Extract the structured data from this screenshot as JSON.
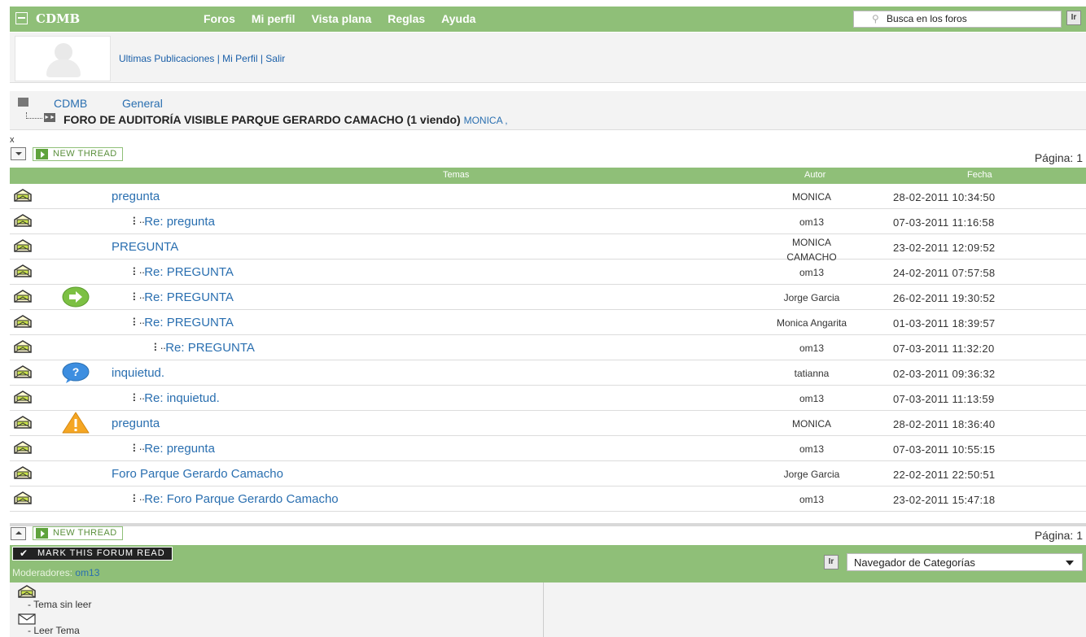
{
  "topbar": {
    "brand": "CDMB",
    "nav": [
      "Foros",
      "Mi perfil",
      "Vista plana",
      "Reglas",
      "Ayuda"
    ],
    "search_placeholder": "Busca en los foros",
    "go_label": "Ir"
  },
  "userpanel": {
    "links": "Ultimas Publicaciones | Mi Perfil | Salir"
  },
  "breadcrumb": {
    "root": "CDMB",
    "category": "General",
    "forum": "FORO DE AUDITORÍA VISIBLE PARQUE GERARDO CAMACHO (1 viendo)",
    "viewers": "MONICA ,"
  },
  "controls": {
    "close": "x",
    "new_thread": "NEW THREAD",
    "page": "Página: 1"
  },
  "table": {
    "headers": {
      "topics": "Temas",
      "author": "Autor",
      "date": "Fecha"
    },
    "rows": [
      {
        "subject": "pregunta",
        "level": 0,
        "author": "MONICA",
        "date": "28-02-2011 10:34:50",
        "icon": ""
      },
      {
        "subject": "Re: pregunta",
        "level": 1,
        "author": "om13",
        "date": "07-03-2011 11:16:58",
        "icon": ""
      },
      {
        "subject": "PREGUNTA",
        "level": 0,
        "author": "MONICA CAMACHO",
        "date": "23-02-2011 12:09:52",
        "icon": ""
      },
      {
        "subject": "Re: PREGUNTA",
        "level": 1,
        "author": "om13",
        "date": "24-02-2011 07:57:58",
        "icon": ""
      },
      {
        "subject": "Re: PREGUNTA",
        "level": 1,
        "author": "Jorge Garcia",
        "date": "26-02-2011 19:30:52",
        "icon": "arrow-icon"
      },
      {
        "subject": "Re: PREGUNTA",
        "level": 1,
        "author": "Monica Angarita",
        "date": "01-03-2011 18:39:57",
        "icon": ""
      },
      {
        "subject": "Re: PREGUNTA",
        "level": 2,
        "author": "om13",
        "date": "07-03-2011 11:32:20",
        "icon": ""
      },
      {
        "subject": "inquietud.",
        "level": 0,
        "author": "tatianna",
        "date": "02-03-2011 09:36:32",
        "icon": "question-icon"
      },
      {
        "subject": "Re: inquietud.",
        "level": 1,
        "author": "om13",
        "date": "07-03-2011 11:13:59",
        "icon": ""
      },
      {
        "subject": "pregunta",
        "level": 0,
        "author": "MONICA",
        "date": "28-02-2011 18:36:40",
        "icon": "warning-icon"
      },
      {
        "subject": "Re: pregunta",
        "level": 1,
        "author": "om13",
        "date": "07-03-2011 10:55:15",
        "icon": ""
      },
      {
        "subject": "Foro Parque Gerardo Camacho",
        "level": 0,
        "author": "Jorge Garcia",
        "date": "22-02-2011 22:50:51",
        "icon": ""
      },
      {
        "subject": "Re: Foro Parque Gerardo Camacho",
        "level": 1,
        "author": "om13",
        "date": "23-02-2011 15:47:18",
        "icon": ""
      }
    ]
  },
  "footer": {
    "mark_read": "MARK THIS FORUM READ",
    "moderators_label": "Moderadores:",
    "moderator": "om13",
    "go_label": "Ir",
    "category_nav": "Navegador de Categorías",
    "legend_unread": "- Tema sin leer",
    "legend_read": "- Leer Tema"
  },
  "colors": {
    "accent": "#8fbf78",
    "link": "#2a6fb0"
  }
}
